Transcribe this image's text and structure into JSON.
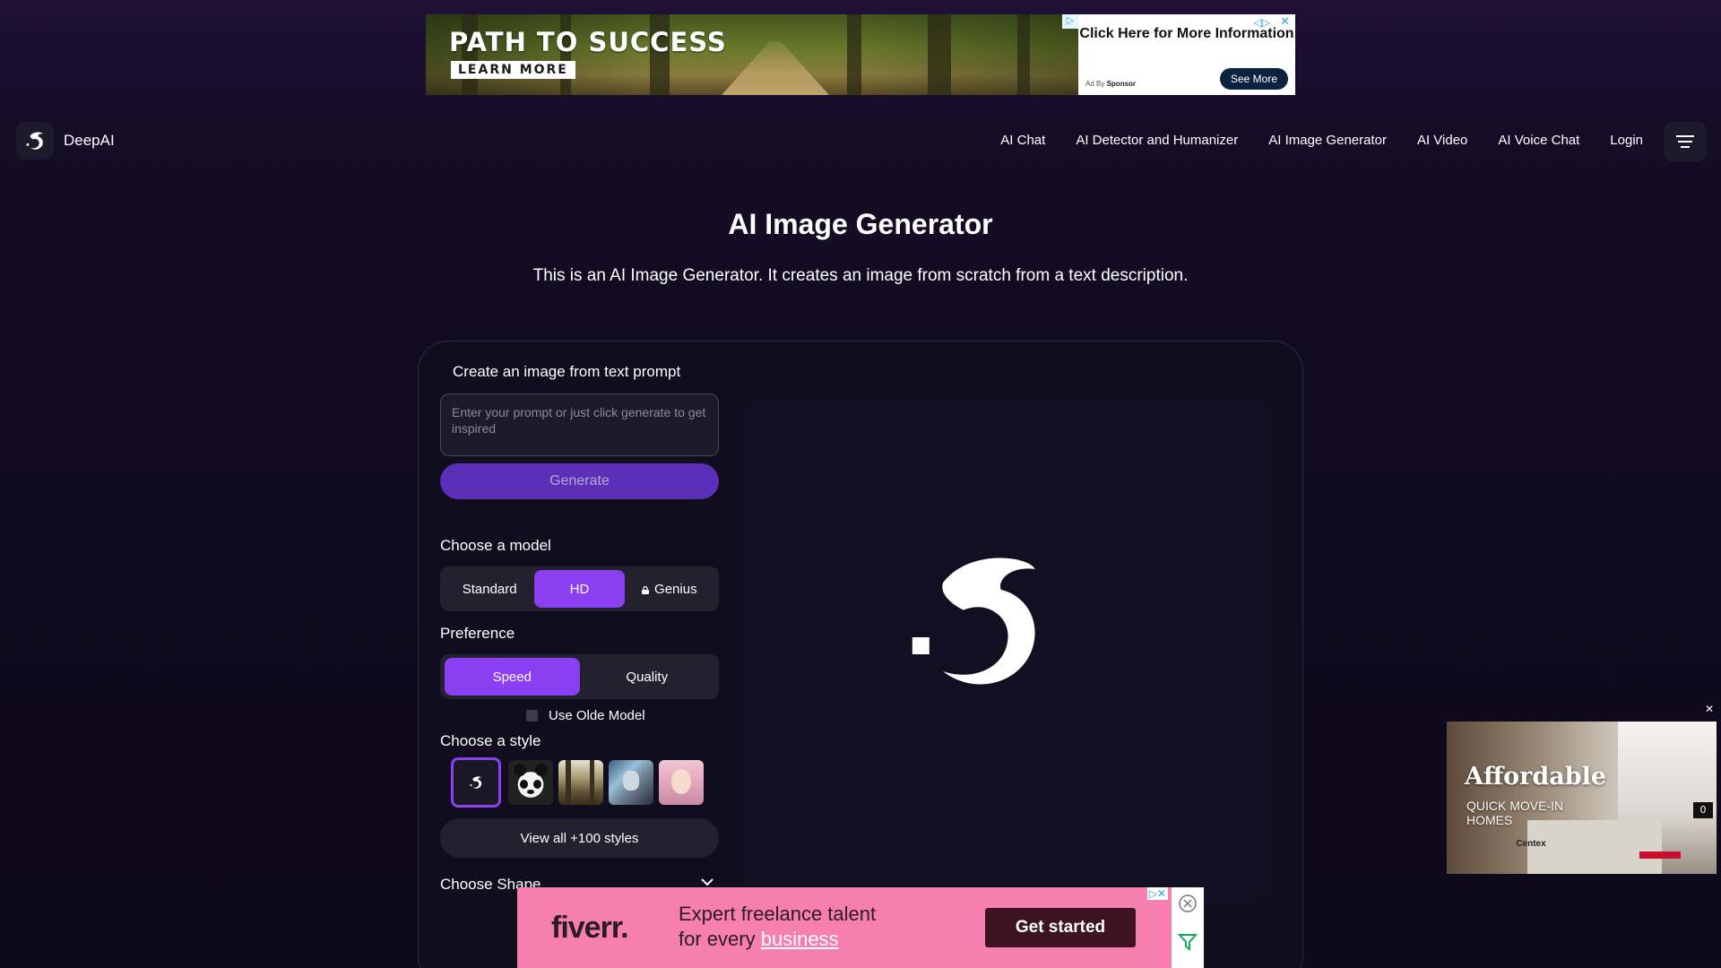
{
  "top_ad": {
    "headline": "PATH TO SUCCESS",
    "button": "LEARN MORE",
    "side_text": "Click Here for More Information",
    "sponsor_prefix": "Ad By",
    "sponsor_name": "Sponsor",
    "see_more": "See More"
  },
  "header": {
    "brand": "DeepAI",
    "nav": [
      "AI Chat",
      "AI Detector and Humanizer",
      "AI Image Generator",
      "AI Video",
      "AI Voice Chat",
      "Login"
    ]
  },
  "hero": {
    "title": "AI Image Generator",
    "description": "This is an AI Image Generator. It creates an image from scratch from a text description."
  },
  "generator": {
    "panel_title": "Create an image from text prompt",
    "prompt_placeholder": "Enter your prompt or just click generate to get inspired",
    "generate_label": "Generate",
    "model_label": "Choose a model",
    "models": [
      "Standard",
      "HD",
      "Genius"
    ],
    "selected_model": "HD",
    "preference_label": "Preference",
    "preferences": [
      "Speed",
      "Quality"
    ],
    "selected_preference": "Speed",
    "olde_model_label": "Use Olde Model",
    "style_label": "Choose a style",
    "view_all_label": "View all +100 styles",
    "shape_label": "Choose Shape"
  },
  "bottom_ad": {
    "brand": "fiverr.",
    "line1": "Expert freelance talent",
    "line2_prefix": "for every",
    "line2_link": "business",
    "cta": "Get started"
  },
  "video_ad": {
    "headline": "Affordable",
    "subline": "QUICK MOVE-IN HOMES",
    "brand": "Centex",
    "counter": "0"
  },
  "colors": {
    "accent": "#8a3ff2",
    "generate_bg": "#5b2fb8",
    "page_bg": "#100b20"
  }
}
